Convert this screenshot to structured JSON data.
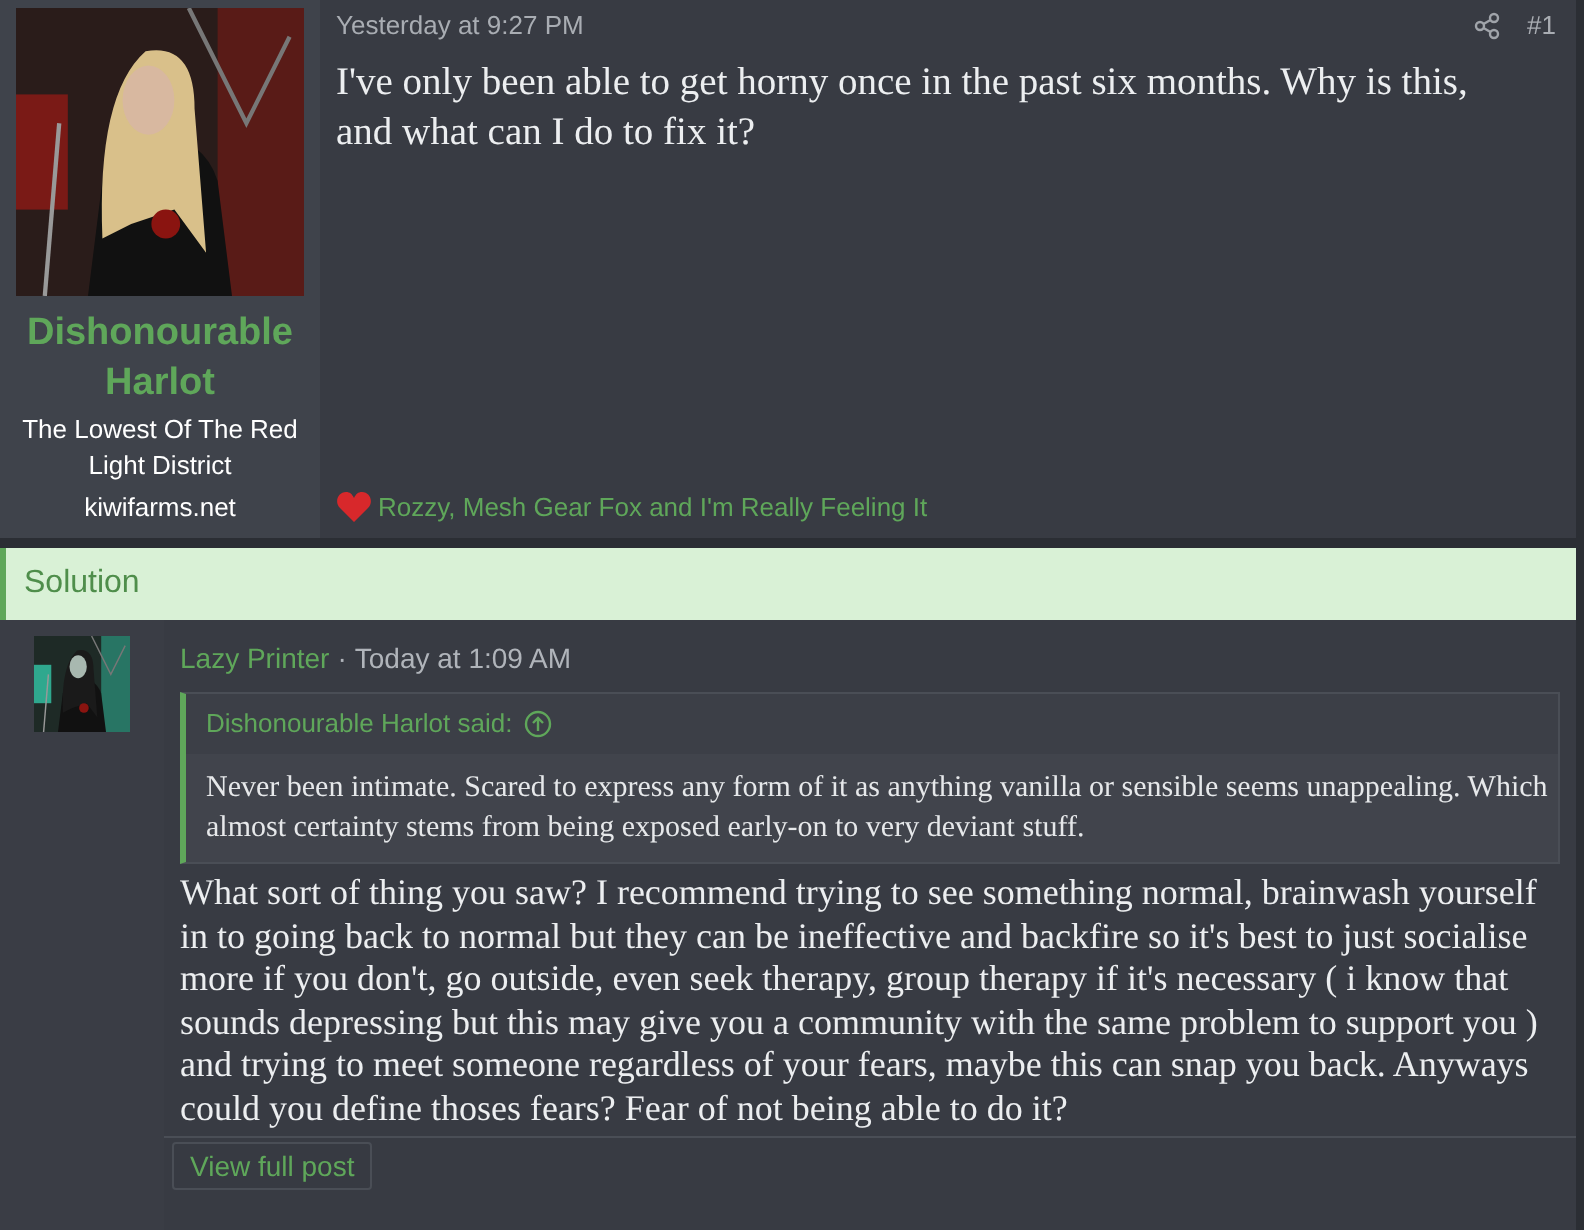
{
  "first_post": {
    "author": {
      "name": "Dishonourable Harlot",
      "title": "The Lowest Of The Red Light District",
      "site": "kiwifarms.net"
    },
    "time": "Yesterday at 9:27 PM",
    "number": "#1",
    "body": "I've only been able to get horny once in the past six months. Why is this, and what can I do to fix it?",
    "reactions": "Rozzy, Mesh Gear Fox and I'm Really Feeling It"
  },
  "solution": {
    "label": "Solution",
    "post": {
      "author": "Lazy Printer",
      "separator": "·",
      "time": "Today at 1:09 AM",
      "quote": {
        "attribution": "Dishonourable Harlot said:",
        "text": "Never been intimate. Scared to express any form of it as anything vanilla or sensible seems unappealing. Which almost certainty stems from being exposed early-on to very deviant stuff."
      },
      "body": "What sort of thing you saw? I recommend trying to see something normal, brainwash yourself in to going back to normal but they can be ineffective and backfire so it's best to just socialise more if you don't, go outside, even seek therapy, group therapy if it's necessary ( i know that sounds depressing but this may give you a community with the same problem to support you ) and trying to meet someone regardless of your fears, maybe this can snap you back. Anyways could you define thoses fears? Fear of not being able to do it?",
      "button": "View full post"
    }
  }
}
